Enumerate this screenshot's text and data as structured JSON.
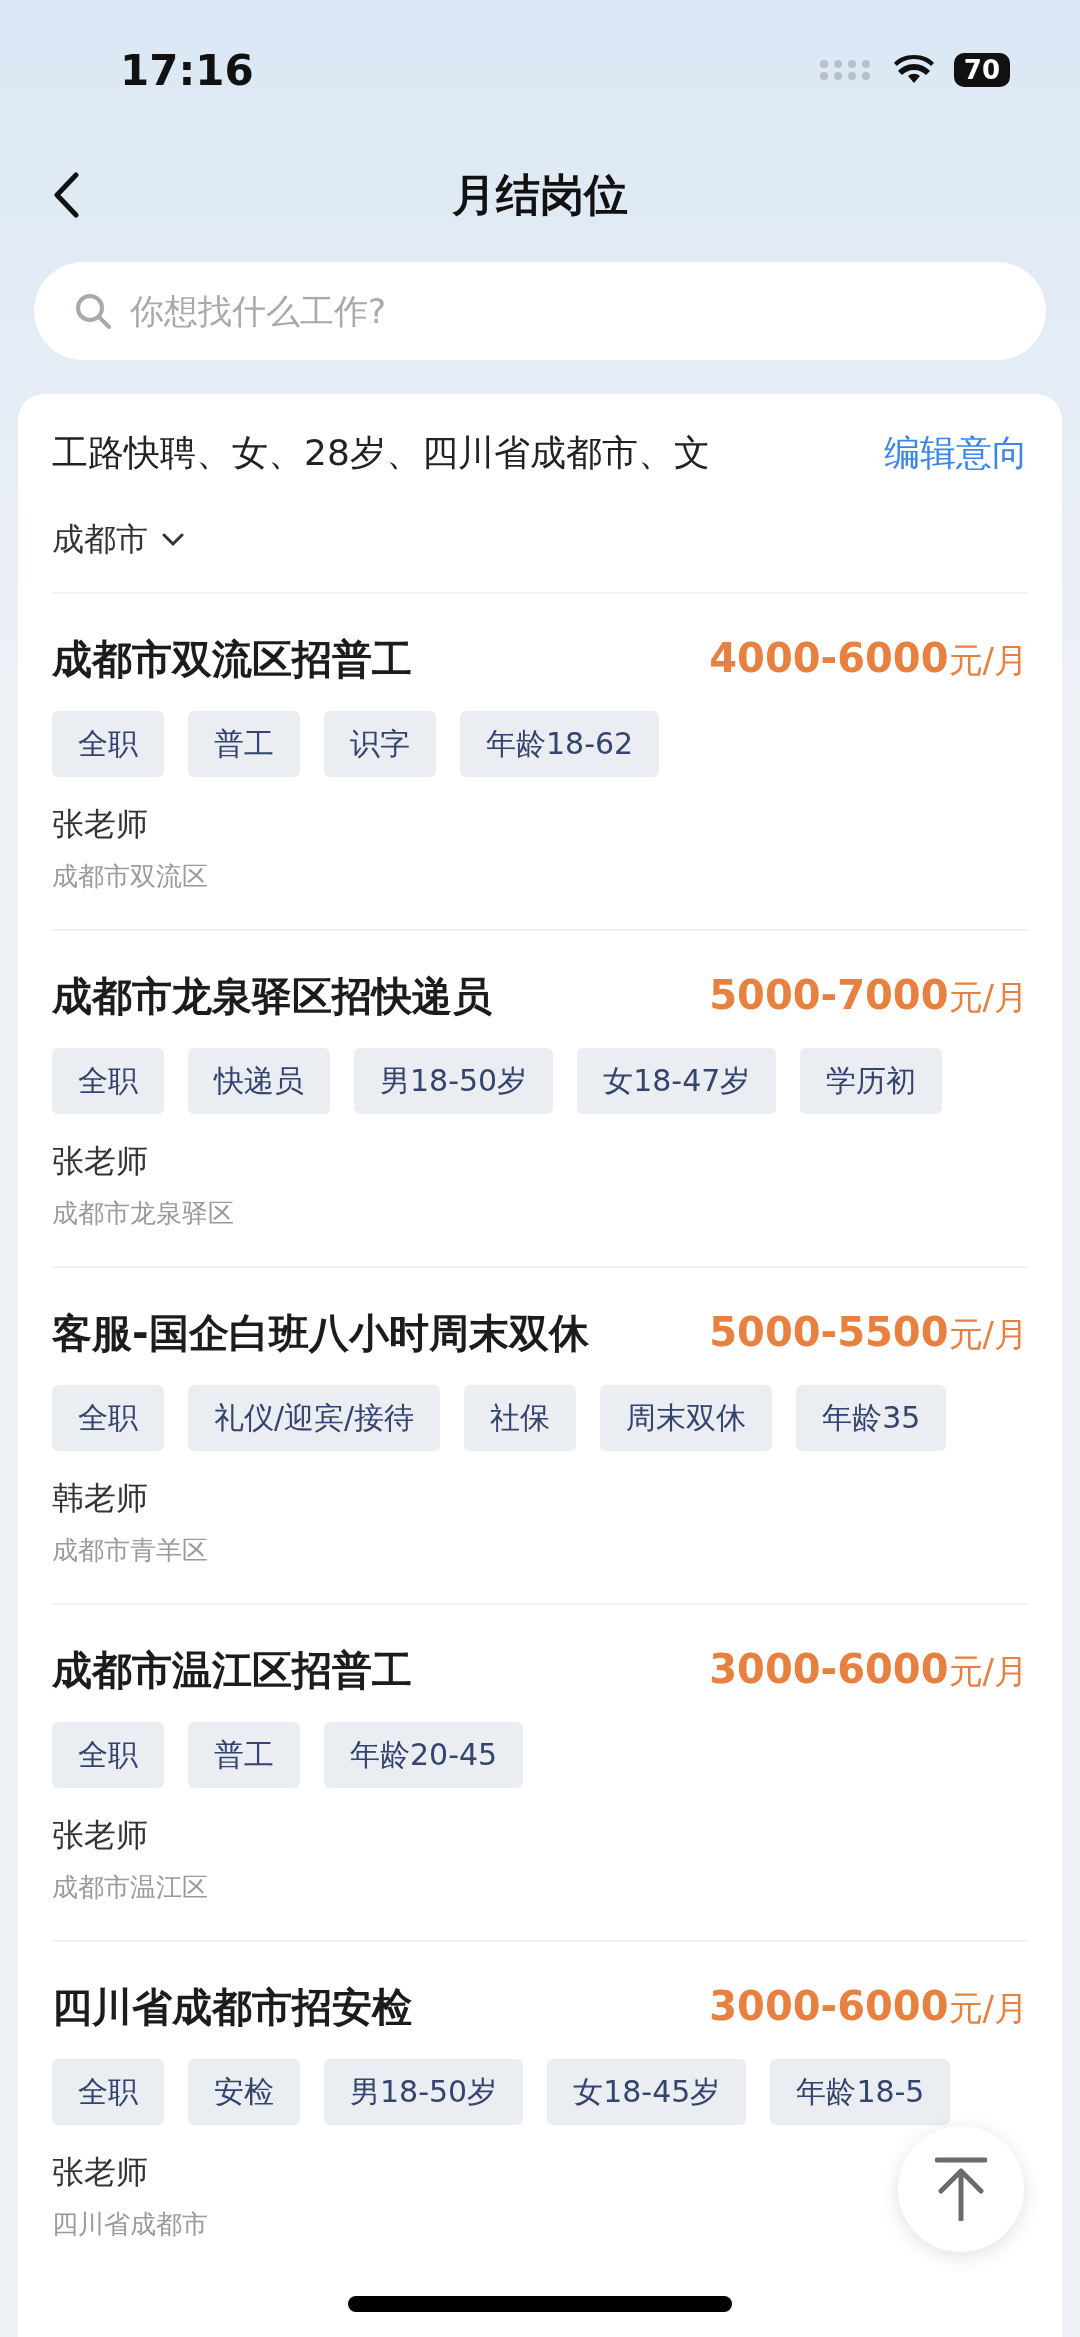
{
  "status_bar": {
    "time": "17:16",
    "battery": "70"
  },
  "header": {
    "title": "月结岗位"
  },
  "search": {
    "placeholder": "你想找什么工作?"
  },
  "intent": {
    "summary": "工路快聘、女、28岁、四川省成都市、文",
    "edit_link": "编辑意向",
    "city": "成都市"
  },
  "jobs": [
    {
      "title": "成都市双流区招普工",
      "salary": "4000-6000",
      "unit": "元/月",
      "tags": [
        "全职",
        "普工",
        "识字",
        "年龄18-62"
      ],
      "contact": "张老师",
      "location": "成都市双流区"
    },
    {
      "title": "成都市龙泉驿区招快递员",
      "salary": "5000-7000",
      "unit": "元/月",
      "tags": [
        "全职",
        "快递员",
        "男18-50岁",
        "女18-47岁",
        "学历初"
      ],
      "contact": "张老师",
      "location": "成都市龙泉驿区"
    },
    {
      "title": "客服-国企白班八小时周末双休",
      "salary": "5000-5500",
      "unit": "元/月",
      "tags": [
        "全职",
        "礼仪/迎宾/接待",
        "社保",
        "周末双休",
        "年龄35"
      ],
      "contact": "韩老师",
      "location": "成都市青羊区"
    },
    {
      "title": "成都市温江区招普工",
      "salary": "3000-6000",
      "unit": "元/月",
      "tags": [
        "全职",
        "普工",
        "年龄20-45"
      ],
      "contact": "张老师",
      "location": "成都市温江区"
    },
    {
      "title": "四川省成都市招安检",
      "salary": "3000-6000",
      "unit": "元/月",
      "tags": [
        "全职",
        "安检",
        "男18-50岁",
        "女18-45岁",
        "年龄18-5"
      ],
      "contact": "张老师",
      "location": "四川省成都市"
    }
  ]
}
